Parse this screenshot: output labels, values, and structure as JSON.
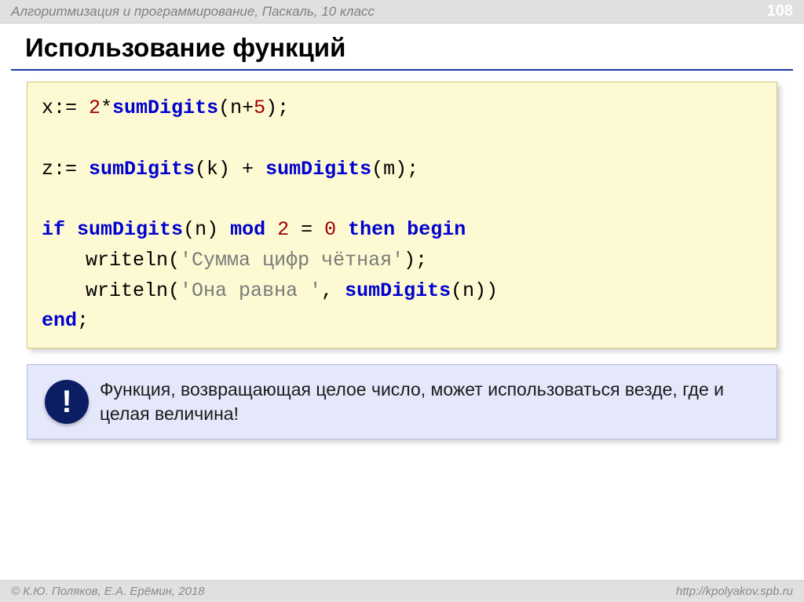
{
  "header": {
    "breadcrumb": "Алгоритмизация и программирование, Паскаль, 10 класс",
    "page_number": "108"
  },
  "title": "Использование функций",
  "code": {
    "l1": {
      "a": "x:= ",
      "n1": "2",
      "star": "*",
      "fn": "sumDigits",
      "b": "(n+",
      "n2": "5",
      "c": ");"
    },
    "l2": {
      "a": "z:= ",
      "fn1": "sumDigits",
      "b": "(k) + ",
      "fn2": "sumDigits",
      "c": "(m);"
    },
    "l3": {
      "if": "if",
      "sp1": " ",
      "fn": "sumDigits",
      "paren": "(n) ",
      "mod": "mod",
      "sp2": " ",
      "two": "2",
      "sp3": " = ",
      "zero": "0",
      "sp4": " ",
      "then": "then",
      "sp5": " ",
      "begin": "begin"
    },
    "l4": {
      "wr": "writeln",
      "open": "(",
      "str": "'Сумма цифр чётная'",
      "close": ");"
    },
    "l5": {
      "wr": "writeln",
      "open": "(",
      "str": "'Она равна '",
      "comma": ", ",
      "fn": "sumDigits",
      "tail": "(n))"
    },
    "l6": {
      "end": "end",
      "semi": ";"
    }
  },
  "callout": {
    "badge": "!",
    "text": "Функция, возвращающая целое число, может использоваться везде, где и целая величина!"
  },
  "footer": {
    "left": "© К.Ю. Поляков, Е.А. Ерёмин, 2018",
    "right": "http://kpolyakov.spb.ru"
  }
}
